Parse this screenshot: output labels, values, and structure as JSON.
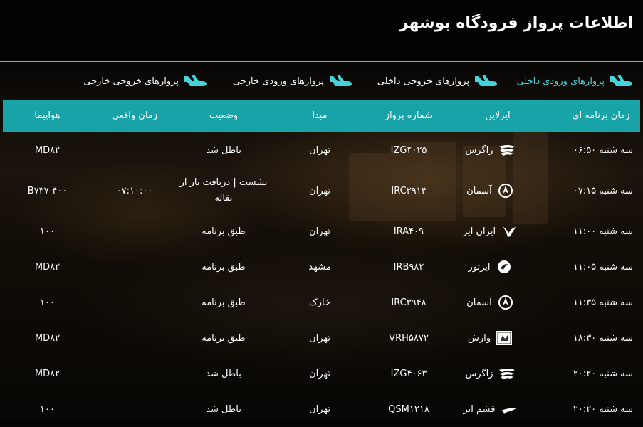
{
  "title": "اطلاعات پرواز فرودگاه بوشهر",
  "tabs": [
    {
      "label": "پروازهای ورودی داخلی",
      "active": true
    },
    {
      "label": "پروازهای خروجی داخلی",
      "active": false
    },
    {
      "label": "پروازهای ورودی خارجی",
      "active": false
    },
    {
      "label": "پروازهای خروجی خارجی",
      "active": false
    }
  ],
  "columns": {
    "scheduled": "زمان برنامه ای",
    "airline": "ایرلاین",
    "flight": "شماره پرواز",
    "origin": "مبدا",
    "status": "وضعیت",
    "actual": "زمان واقعی",
    "aircraft": "هواپیما"
  },
  "rows": [
    {
      "scheduled": "سه شنبه ۰۶:۵۰",
      "airline": "زاگرس",
      "airline_icon": "zagros-logo-icon",
      "flight": "IZG۴۰۲۵",
      "origin": "تهران",
      "status": "باطل شد",
      "actual": "",
      "aircraft": "MD۸۲"
    },
    {
      "scheduled": "سه شنبه ۰۷:۱۵",
      "airline": "آسمان",
      "airline_icon": "aseman-logo-icon",
      "flight": "IRC۳۹۱۴",
      "origin": "تهران",
      "status": "نشست | دریافت بار از نقاله",
      "actual": "۰۷:۱۰:۰۰",
      "aircraft": "B۷۳۷-۴۰۰"
    },
    {
      "scheduled": "سه شنبه ۱۱:۰۰",
      "airline": "ایران ایر",
      "airline_icon": "iranair-logo-icon",
      "flight": "IRA۴۰۹",
      "origin": "تهران",
      "status": "طبق برنامه",
      "actual": "",
      "aircraft": "۱۰۰"
    },
    {
      "scheduled": "سه شنبه ۱۱:۰۵",
      "airline": "ایرتور",
      "airline_icon": "airtour-logo-icon",
      "flight": "IRB۹۸۲",
      "origin": "مشهد",
      "status": "طبق برنامه",
      "actual": "",
      "aircraft": "MD۸۲"
    },
    {
      "scheduled": "سه شنبه ۱۱:۳۵",
      "airline": "آسمان",
      "airline_icon": "aseman-logo-icon",
      "flight": "IRC۳۹۴۸",
      "origin": "خارک",
      "status": "طبق برنامه",
      "actual": "",
      "aircraft": "۱۰۰"
    },
    {
      "scheduled": "سه شنبه ۱۸:۳۰",
      "airline": "وارش",
      "airline_icon": "varesh-logo-icon",
      "flight": "VRH۵۸۷۲",
      "origin": "تهران",
      "status": "طبق برنامه",
      "actual": "",
      "aircraft": "MD۸۲"
    },
    {
      "scheduled": "سه شنبه ۲۰:۲۰",
      "airline": "زاگرس",
      "airline_icon": "zagros-logo-icon",
      "flight": "IZG۴۰۶۳",
      "origin": "تهران",
      "status": "باطل شد",
      "actual": "",
      "aircraft": "MD۸۲"
    },
    {
      "scheduled": "سه شنبه ۲۰:۲۰",
      "airline": "قشم ایر",
      "airline_icon": "qeshm-logo-icon",
      "flight": "QSM۱۲۱۸",
      "origin": "تهران",
      "status": "باطل شد",
      "actual": "",
      "aircraft": "۱۰۰"
    }
  ],
  "colors": {
    "accent": "#17a3a8",
    "active_tab": "#44d3da",
    "header_bg": "#020202",
    "divider": "#3ec8cf"
  }
}
